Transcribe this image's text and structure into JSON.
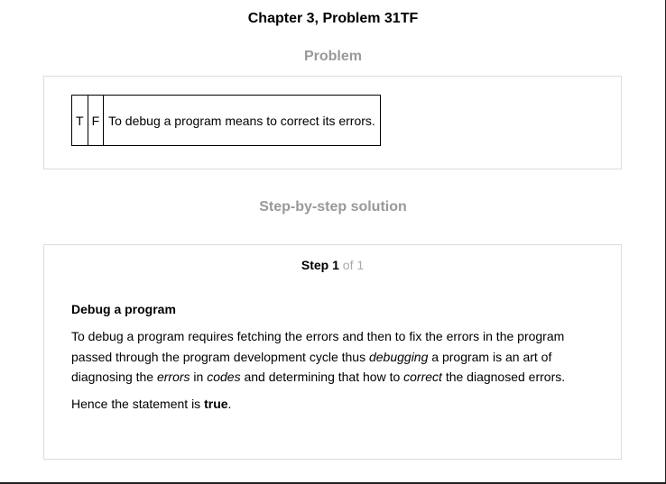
{
  "page": {
    "title": "Chapter 3, Problem 31TF"
  },
  "problem": {
    "heading": "Problem",
    "true_label": "T",
    "false_label": "F",
    "statement": "To debug a program means to correct its errors."
  },
  "solution": {
    "heading": "Step-by-step solution",
    "step": {
      "label": "Step",
      "number": "1",
      "of_text": "of 1"
    },
    "subheading": "Debug a program",
    "paragraph": {
      "part1": "To debug a program requires fetching the errors and then to fix the errors in the program passed through the program development cycle thus ",
      "em1": "debugging",
      "part2": " a program is an art of diagnosing the ",
      "em2": "errors",
      "part3": " in ",
      "em3": "codes",
      "part4": " and determining that how to ",
      "em4": "correct",
      "part5": " the diagnosed errors."
    },
    "conclusion": {
      "prefix": "Hence the statement is ",
      "answer": "true",
      "suffix": "."
    }
  }
}
